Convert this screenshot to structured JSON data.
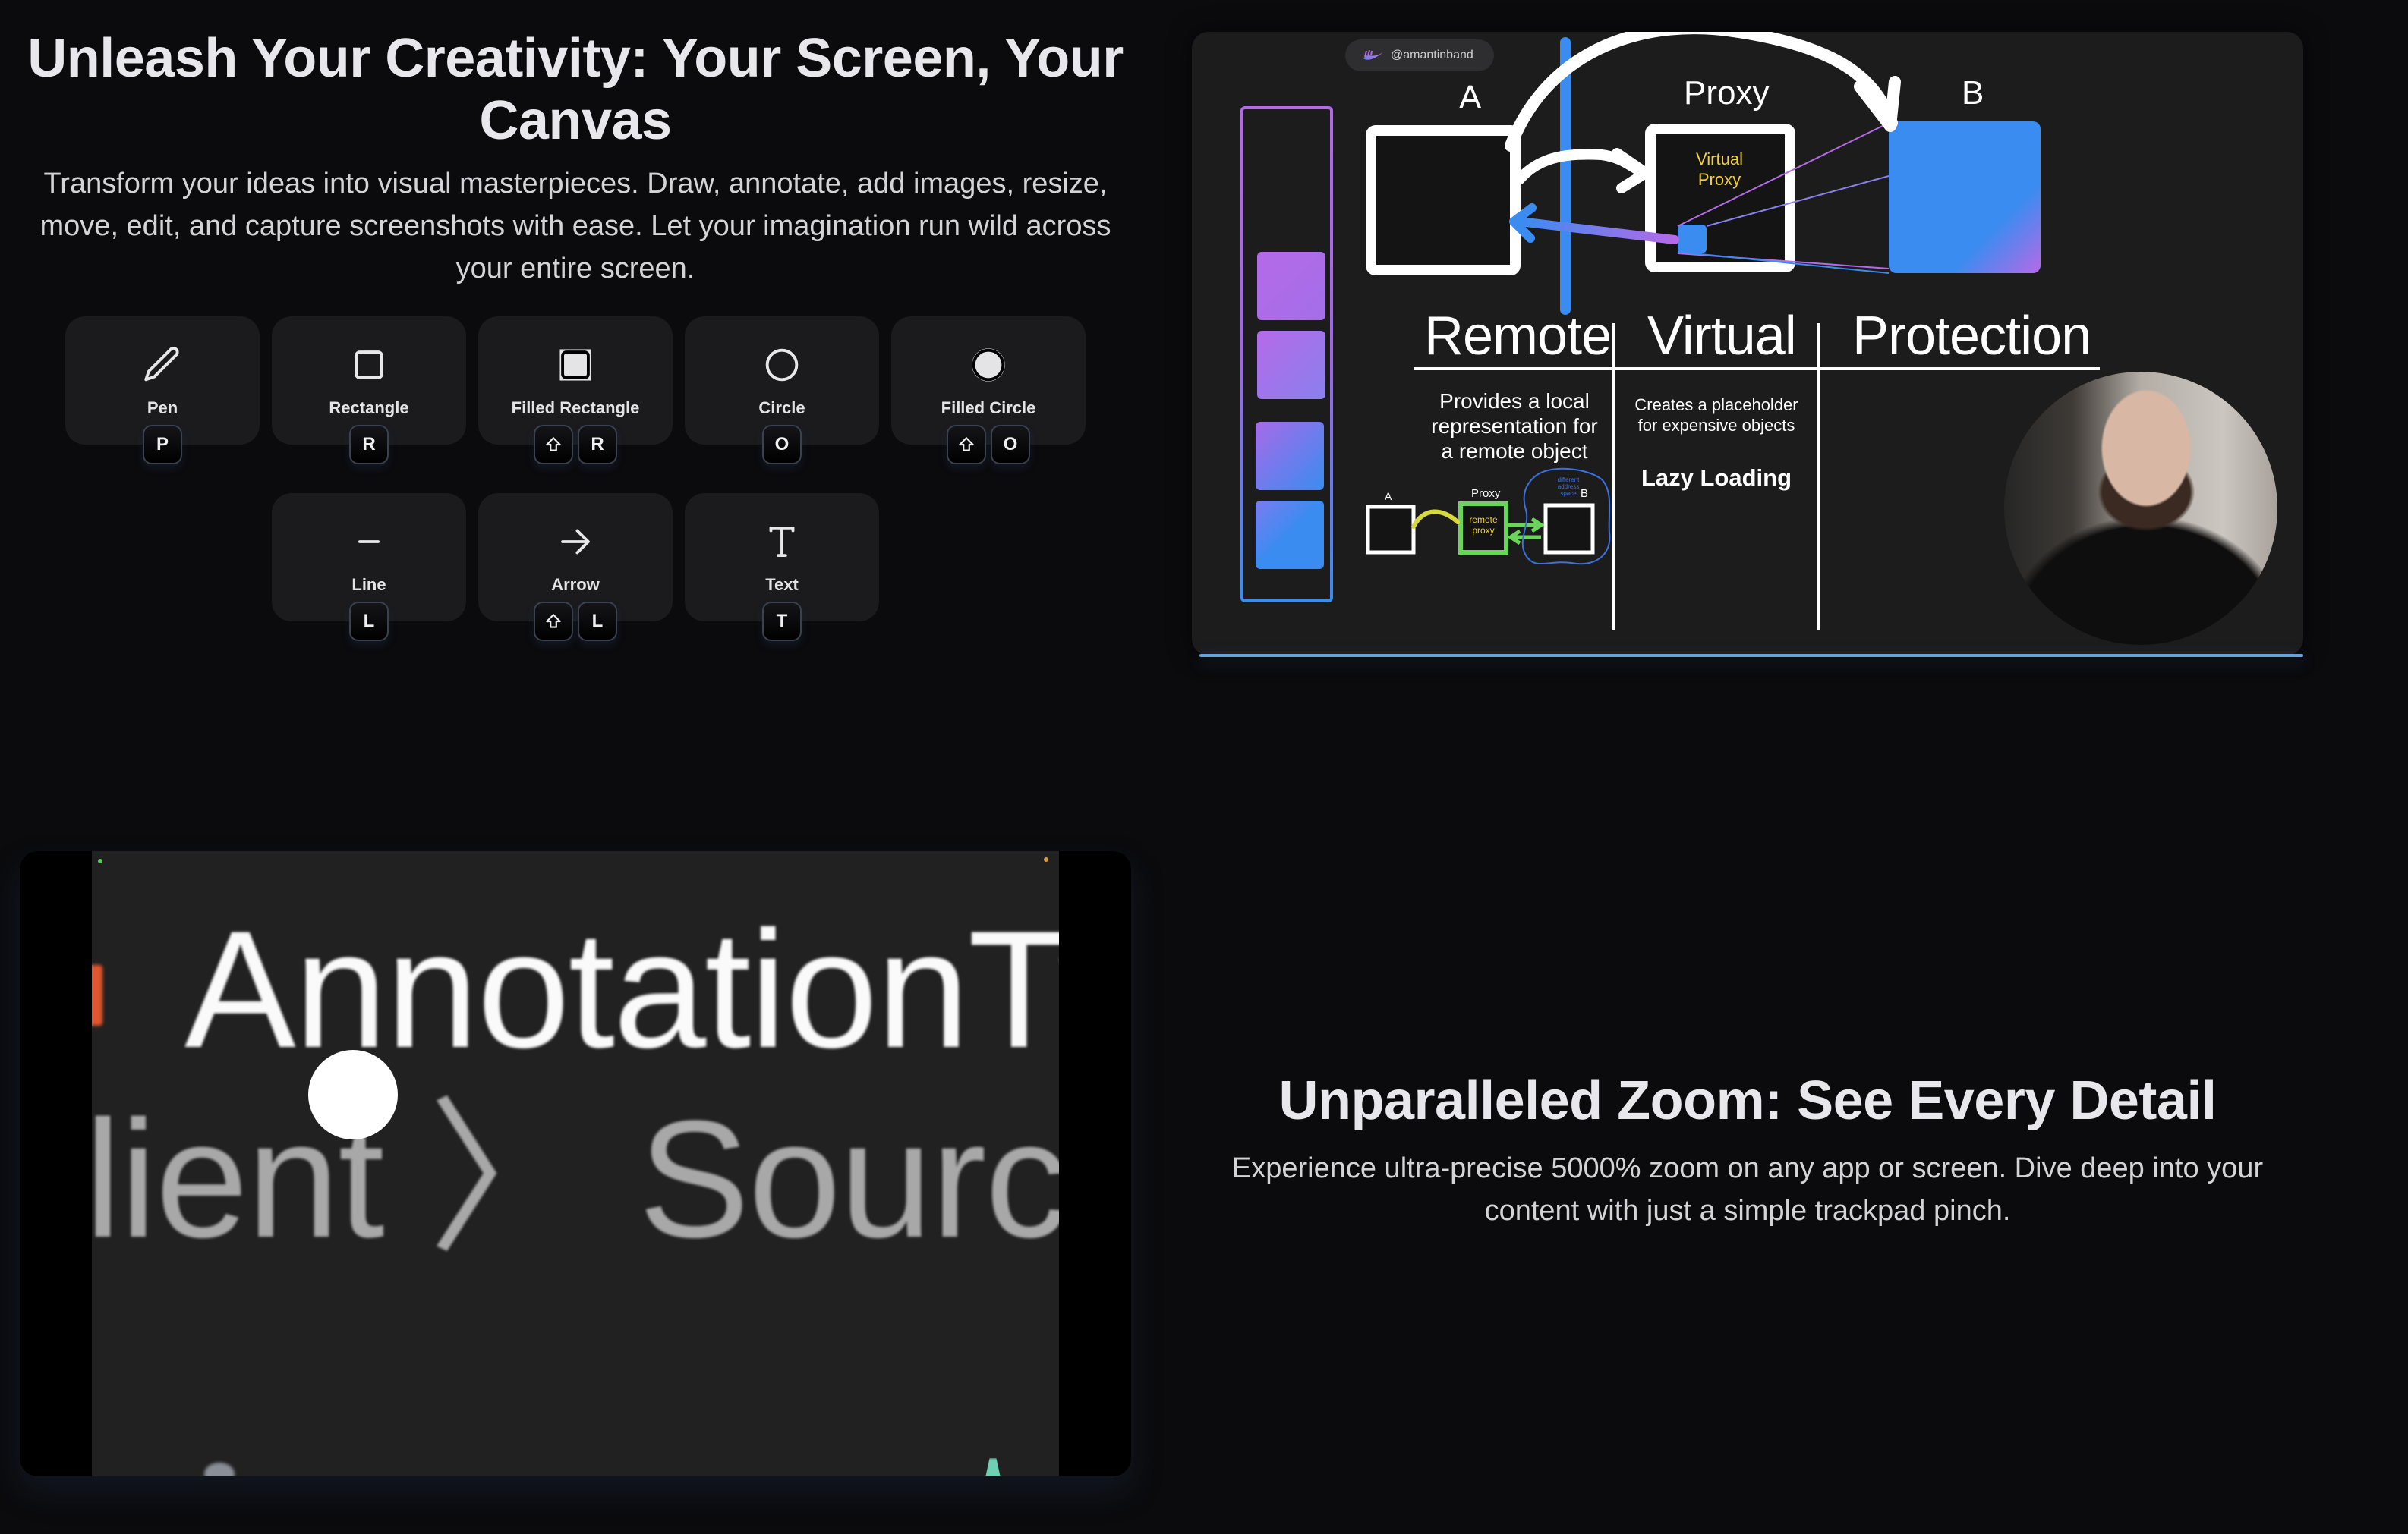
{
  "section_draw": {
    "title": "Unleash Your Creativity: Your Screen, Your Canvas",
    "description": "Transform your ideas into visual masterpieces. Draw, annotate, add images, resize, move, edit, and capture screenshots with ease. Let your imagination run wild across your entire screen.",
    "tools": [
      {
        "label": "Pen",
        "icon": "pen-icon",
        "keys": [
          "P"
        ]
      },
      {
        "label": "Rectangle",
        "icon": "rectangle-icon",
        "keys": [
          "R"
        ]
      },
      {
        "label": "Filled Rectangle",
        "icon": "filled-rectangle-icon",
        "keys": [
          "⇧",
          "R"
        ]
      },
      {
        "label": "Circle",
        "icon": "circle-icon",
        "keys": [
          "O"
        ]
      },
      {
        "label": "Filled Circle",
        "icon": "filled-circle-icon",
        "keys": [
          "⇧",
          "O"
        ]
      },
      {
        "label": "Line",
        "icon": "line-icon",
        "keys": [
          "L"
        ]
      },
      {
        "label": "Arrow",
        "icon": "arrow-icon",
        "keys": [
          "⇧",
          "L"
        ]
      },
      {
        "label": "Text",
        "icon": "text-icon",
        "keys": [
          "T"
        ]
      }
    ]
  },
  "demo_canvas": {
    "handle": "@amantinband",
    "diagram": {
      "node_a": "A",
      "node_proxy": "Proxy",
      "node_b": "B",
      "proxy_inner": [
        "Virtual",
        "Proxy"
      ],
      "categories": [
        "Remote",
        "Virtual",
        "Protection"
      ],
      "remote_desc": [
        "Provides a local",
        "representation for",
        "a remote object"
      ],
      "virtual_desc": [
        "Creates a placeholder",
        "for expensive objects"
      ],
      "virtual_highlight": "Lazy Loading",
      "mini_diagram": {
        "a": "A",
        "proxy": "Proxy",
        "b": "B",
        "proxy_inner": [
          "remote",
          "proxy"
        ],
        "cloud_note": [
          "different",
          "address",
          "space"
        ]
      }
    },
    "colors": {
      "accent_blue": "#3a8cf0",
      "accent_purple": "#b56ae8",
      "proxy_text": "#f0d040",
      "remote_green": "#6bd45a"
    }
  },
  "zoom_demo": {
    "line1": "AnnotationTy",
    "line2": "lient 〉 Sources"
  },
  "section_zoom": {
    "title": "Unparalleled Zoom: See Every Detail",
    "description": "Experience ultra-precise 5000% zoom on any app or screen. Dive deep into your content with just a simple trackpad pinch."
  }
}
